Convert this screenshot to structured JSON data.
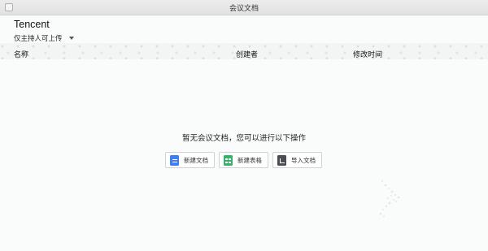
{
  "window": {
    "title": "会议文档"
  },
  "org": {
    "name": "Tencent"
  },
  "permission": {
    "label": "仅主持人可上传"
  },
  "columns": {
    "name": "名称",
    "creator": "创建者",
    "modified": "修改时间"
  },
  "empty_state": {
    "message": "暂无会议文档，您可以进行以下操作",
    "actions": {
      "new_doc": "新建文档",
      "new_sheet": "新建表格",
      "import_doc": "导入文档"
    }
  },
  "colors": {
    "doc_icon": "#3e7df4",
    "sheet_icon": "#35b36a",
    "import_icon": "#4a4d52"
  },
  "icons": [
    "doc-icon",
    "sheet-icon",
    "import-icon",
    "dropdown-caret-icon"
  ]
}
